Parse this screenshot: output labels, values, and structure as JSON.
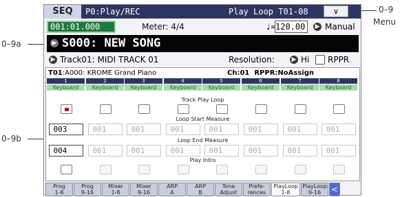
{
  "header": {
    "mode_tab": "SEQ",
    "page_title": "P0:Play/REC",
    "page_right": "Play Loop T01-08",
    "menu_arrow": "∨"
  },
  "locator": {
    "value": "001:01.000"
  },
  "meter": {
    "label": "Meter:",
    "value": "4/4"
  },
  "tempo": {
    "symbol": "♩=",
    "value": "120.00",
    "mode": "Manual"
  },
  "song": {
    "name": "S000: NEW SONG"
  },
  "track_select": {
    "label": "Track01: MIDI TRACK 01"
  },
  "resolution": {
    "label": "Resolution:",
    "value": "Hi"
  },
  "rppr_checkbox_label": "RPPR",
  "info": {
    "track": "T01",
    "program": ":A000: KROME Grand Piano",
    "channel": "Ch:01",
    "rppr": "RPPR:NoAssign"
  },
  "columns": [
    "1",
    "2",
    "3",
    "4",
    "5",
    "6",
    "7",
    "8"
  ],
  "keyboard_label": "Keyboard",
  "sections": {
    "track_play_loop": "Track Play Loop",
    "loop_start": "Loop Start Measure",
    "loop_end": "Loop End Measure",
    "play_intro": "Play Intro"
  },
  "loop_start_values": [
    "003",
    "001",
    "001",
    "001",
    "001",
    "001",
    "001",
    "001"
  ],
  "loop_end_values": [
    "004",
    "001",
    "001",
    "001",
    "001",
    "001",
    "001",
    "001"
  ],
  "tabs": [
    {
      "label": "Prog\n1-8"
    },
    {
      "label": "Prog\n9-16"
    },
    {
      "label": "Mixer\n1-8"
    },
    {
      "label": "Mixer\n9-16"
    },
    {
      "label": "ARP\nA"
    },
    {
      "label": "ARP\nB"
    },
    {
      "label": "Tone\nAdjust"
    },
    {
      "label": "Prefe-\nrences"
    },
    {
      "label": "PlayLoop\n1-8"
    },
    {
      "label": "PlayLoop\n9-16"
    },
    {
      "label": "<"
    }
  ],
  "annotations": {
    "menu_ref": "0–9",
    "menu_word": "Menu",
    "ref_a": "0–9a",
    "ref_b": "0–9b"
  }
}
